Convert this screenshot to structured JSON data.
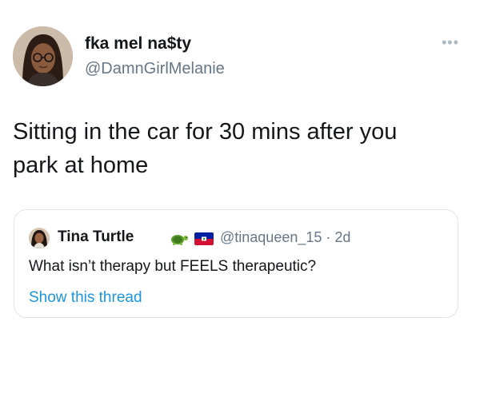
{
  "author": {
    "display_name": "fka mel na$ty",
    "handle": "@DamnGirlMelanie",
    "avatar_icon": "profile-photo"
  },
  "more_icon": "ellipsis-icon",
  "more_glyph": "•••",
  "tweet": {
    "lines": [
      "Sitting in the car for 30 mins after you",
      "park at home"
    ]
  },
  "quoted_tweet": {
    "display_name": "Tina Turtle",
    "emoji": [
      "turtle-emoji",
      "haiti-flag-emoji"
    ],
    "handle_and_time": "@tinaqueen_15 · 2d",
    "text": "What isn’t therapy but FEELS therapeutic?",
    "link_text": "Show this thread"
  },
  "colors": {
    "text": "#14171a",
    "secondary": "#657786",
    "link": "#1b95e0",
    "border": "#dfe4e8"
  }
}
